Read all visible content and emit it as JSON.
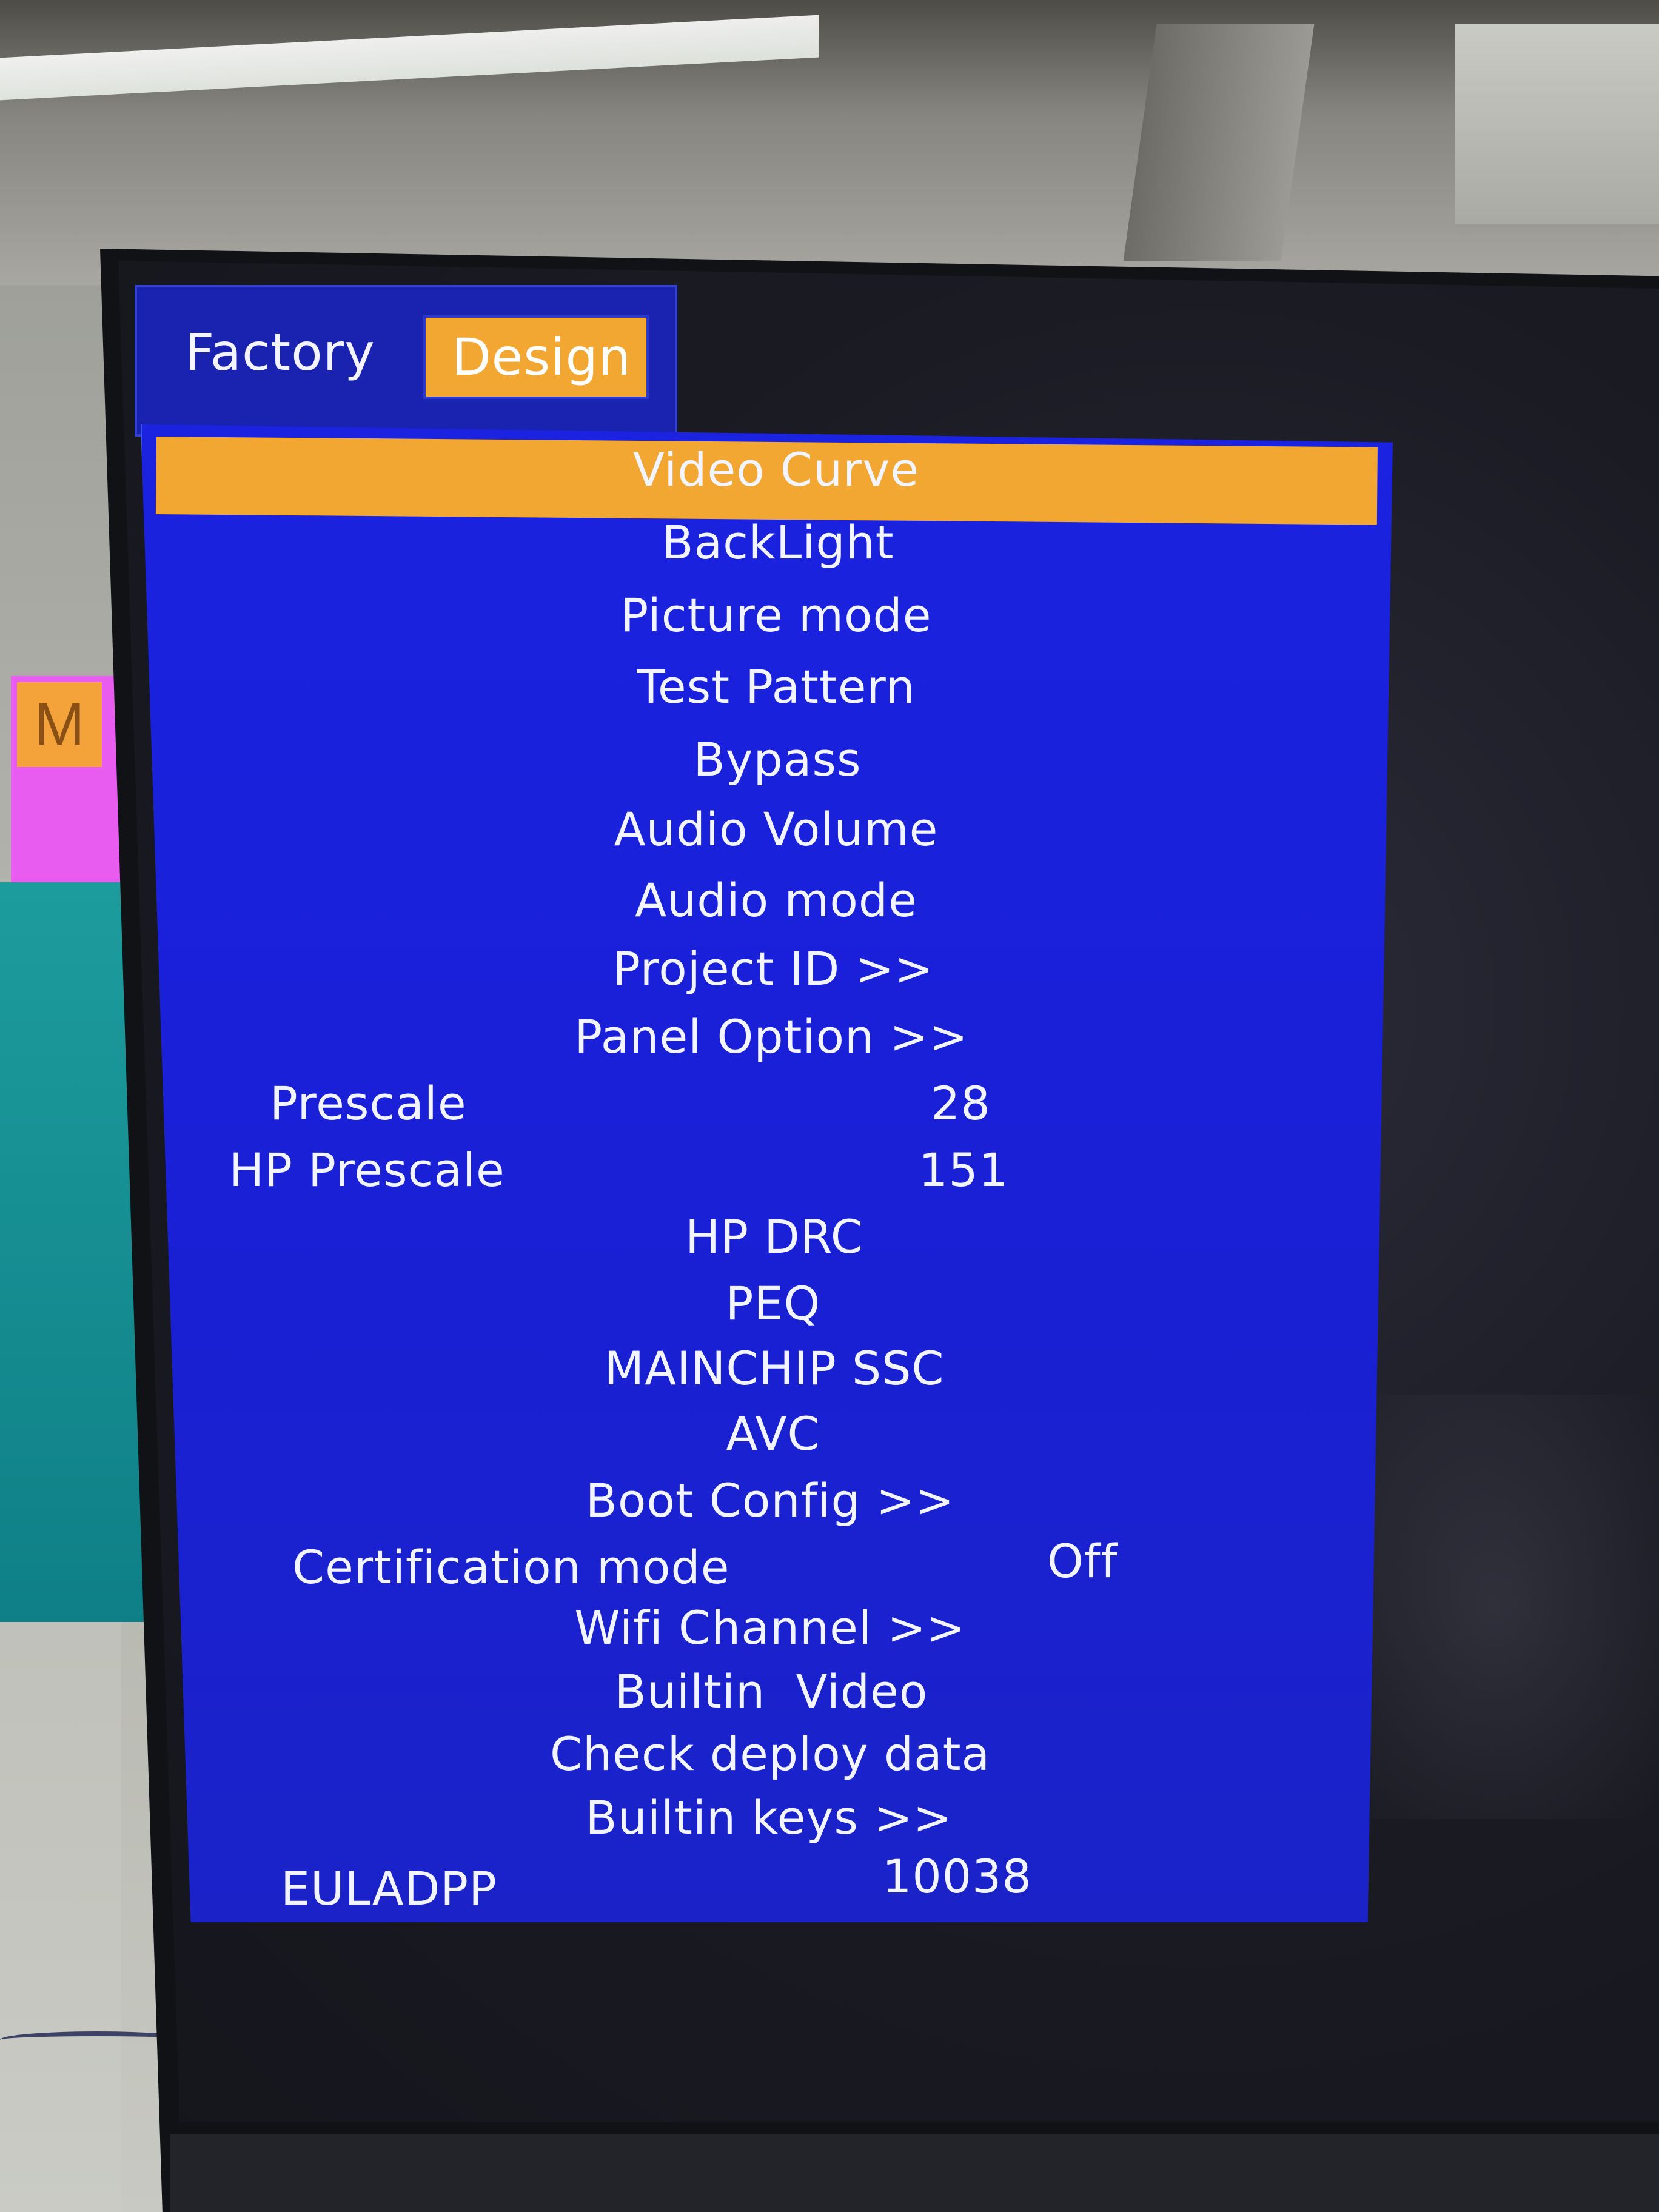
{
  "background": {
    "sticky_note_letter": "M"
  },
  "tabs": {
    "factory_label": "Factory",
    "design_label": "Design",
    "active": "Design"
  },
  "menu": {
    "selected_item": "Video Curve",
    "items": [
      {
        "label": "Video Curve"
      },
      {
        "label": "BackLight"
      },
      {
        "label": "Picture mode"
      },
      {
        "label": "Test Pattern"
      },
      {
        "label": "Bypass"
      },
      {
        "label": "Audio Volume"
      },
      {
        "label": "Audio mode"
      },
      {
        "label": "Project ID >>"
      },
      {
        "label": "Panel Option >>"
      },
      {
        "label": "Prescale",
        "value": "28"
      },
      {
        "label": "HP Prescale",
        "value": "151"
      },
      {
        "label": "HP DRC"
      },
      {
        "label": "PEQ"
      },
      {
        "label": "MAINCHIP SSC"
      },
      {
        "label": "AVC"
      },
      {
        "label": "Boot Config >>"
      },
      {
        "label": "Certification mode",
        "value": "Off"
      },
      {
        "label": "Wifi Channel >>"
      },
      {
        "label": "Builtin  Video"
      },
      {
        "label": "Check deploy data"
      },
      {
        "label": "Builtin keys >>"
      },
      {
        "label": "EULADPP",
        "value": "10038"
      }
    ]
  },
  "colors": {
    "menu_background": "#1b22e0",
    "highlight": "#f2a732",
    "text": "#f2f4ff"
  }
}
